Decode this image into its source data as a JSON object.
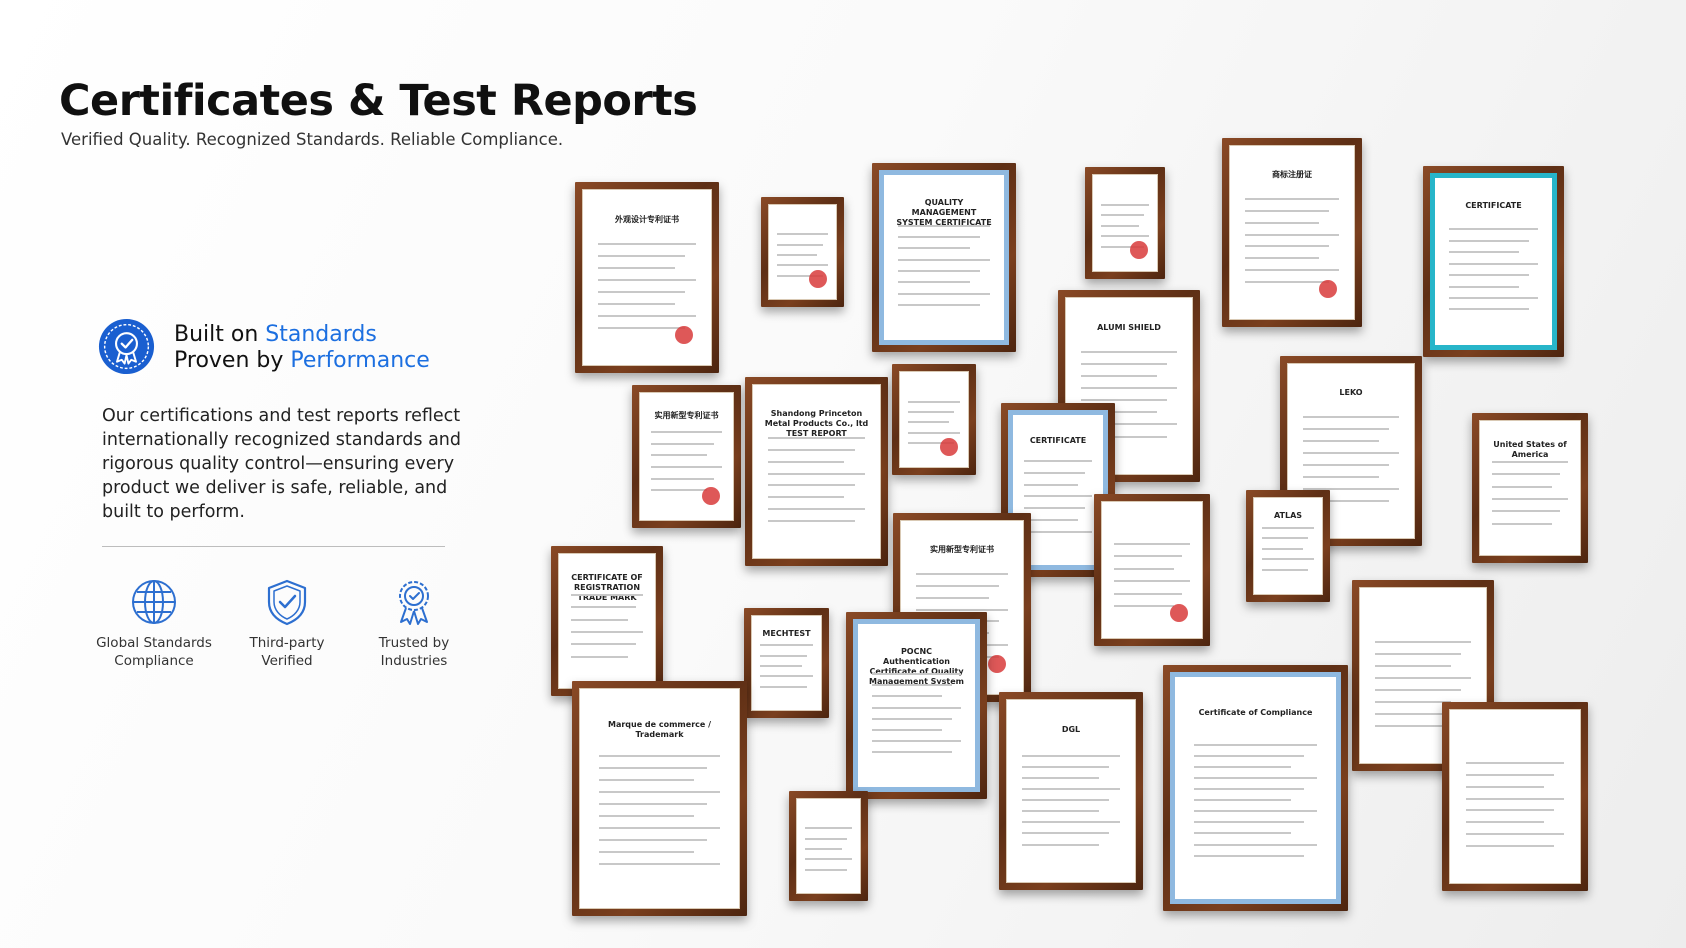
{
  "header": {
    "title": "Certificates & Test Reports",
    "subtitle": "Verified Quality. Recognized Standards. Reliable Compliance."
  },
  "tagline": {
    "line1_prefix": "Built on ",
    "line1_accent": "Standards",
    "line2_prefix": "Proven by ",
    "line2_accent": "Performance"
  },
  "description": "Our certifications and test reports reflect internationally recognized standards and rigorous quality control—ensuring every product we deliver is safe, reliable, and built to perform.",
  "features": [
    {
      "icon": "globe-icon",
      "line1": "Global Standards",
      "line2": "Compliance"
    },
    {
      "icon": "shield-check-icon",
      "line1": "Third-party",
      "line2": "Verified"
    },
    {
      "icon": "award-ribbon-icon",
      "line1": "Trusted by",
      "line2": "Industries"
    }
  ],
  "colors": {
    "accent": "#1c6fe0",
    "frame": "#6b3518",
    "badge": "#1a5fd0"
  },
  "certificates": [
    {
      "text": "外观设计专利证书",
      "style": "cn"
    },
    {
      "text": "",
      "style": "cn"
    },
    {
      "text": "QUALITY MANAGEMENT SYSTEM CERTIFICATE",
      "style": "blue"
    },
    {
      "text": "",
      "style": "cn"
    },
    {
      "text": "商标注册证",
      "style": "cn"
    },
    {
      "text": "CERTIFICATE",
      "style": "green"
    },
    {
      "text": "ALUMI SHIELD",
      "style": "plain"
    },
    {
      "text": "实用新型专利证书",
      "style": "cn"
    },
    {
      "text": "Shandong Princeton Metal Products Co., ltd TEST REPORT",
      "style": "plain"
    },
    {
      "text": "",
      "style": "cn"
    },
    {
      "text": "CERTIFICATE",
      "style": "blue"
    },
    {
      "text": "LEKO",
      "style": "plain"
    },
    {
      "text": "United States of America",
      "style": "plain"
    },
    {
      "text": "CERTIFICATE OF REGISTRATION TRADE MARK",
      "style": "plain"
    },
    {
      "text": "实用新型专利证书",
      "style": "cn"
    },
    {
      "text": "",
      "style": "cn"
    },
    {
      "text": "ATLAS",
      "style": "plain"
    },
    {
      "text": "",
      "style": "cn"
    },
    {
      "text": "MECHTEST",
      "style": "plain"
    },
    {
      "text": "POCNC Authentication Certificate of Quality Management System",
      "style": "blue"
    },
    {
      "text": "Marque de commerce / Trademark",
      "style": "plain"
    },
    {
      "text": "DGL",
      "style": "plain"
    },
    {
      "text": "Certificate of Compliance",
      "style": "blue"
    },
    {
      "text": "",
      "style": "plain"
    },
    {
      "text": "",
      "style": "plain"
    }
  ]
}
